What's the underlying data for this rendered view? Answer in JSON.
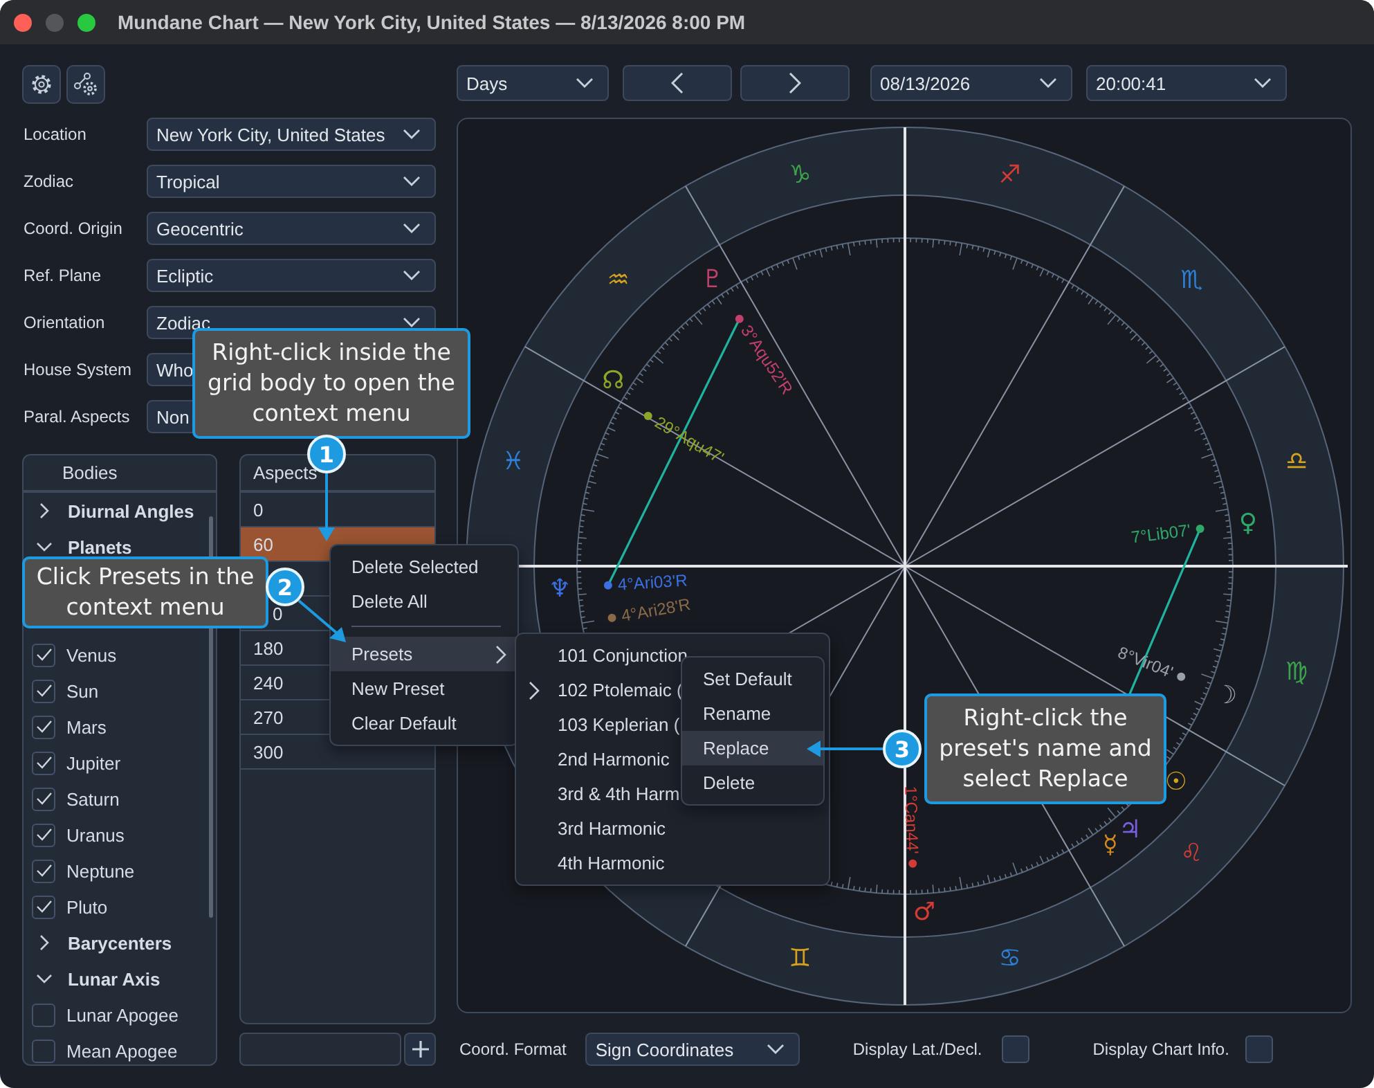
{
  "window": {
    "title": "Mundane Chart — New York City, United States — 8/13/2026 8:00 PM"
  },
  "settings": [
    {
      "label": "Location",
      "value": "New York City, United States"
    },
    {
      "label": "Zodiac",
      "value": "Tropical"
    },
    {
      "label": "Coord. Origin",
      "value": "Geocentric"
    },
    {
      "label": "Ref. Plane",
      "value": "Ecliptic"
    },
    {
      "label": "Orientation",
      "value": "Zodiac"
    },
    {
      "label": "House System",
      "value": "Who"
    },
    {
      "label": "Paral. Aspects",
      "value": "Non"
    }
  ],
  "bodies": {
    "title": "Bodies",
    "items": [
      {
        "kind": "group",
        "label": "Diurnal Angles",
        "expanded": false
      },
      {
        "kind": "group",
        "label": "Planets",
        "expanded": true
      },
      {
        "kind": "covered"
      },
      {
        "kind": "covered"
      },
      {
        "kind": "body",
        "label": "Venus",
        "checked": true
      },
      {
        "kind": "body",
        "label": "Sun",
        "checked": true
      },
      {
        "kind": "body",
        "label": "Mars",
        "checked": true
      },
      {
        "kind": "body",
        "label": "Jupiter",
        "checked": true
      },
      {
        "kind": "body",
        "label": "Saturn",
        "checked": true
      },
      {
        "kind": "body",
        "label": "Uranus",
        "checked": true
      },
      {
        "kind": "body",
        "label": "Neptune",
        "checked": true
      },
      {
        "kind": "body",
        "label": "Pluto",
        "checked": true
      },
      {
        "kind": "group",
        "label": "Barycenters",
        "expanded": false
      },
      {
        "kind": "group",
        "label": "Lunar Axis",
        "expanded": true
      },
      {
        "kind": "body",
        "label": "Lunar Apogee",
        "checked": false
      },
      {
        "kind": "body",
        "label": "Mean Apogee",
        "checked": false
      }
    ]
  },
  "aspects": {
    "title": "Aspects",
    "rows": [
      {
        "kind": "value",
        "value": "0",
        "selected": false
      },
      {
        "kind": "value",
        "value": "60",
        "selected": true
      },
      {
        "kind": "covered"
      },
      {
        "kind": "tail",
        "value": "0",
        "selected": false
      },
      {
        "kind": "value",
        "value": "180",
        "selected": false
      },
      {
        "kind": "value",
        "value": "240",
        "selected": false
      },
      {
        "kind": "value",
        "value": "270",
        "selected": false
      },
      {
        "kind": "value",
        "value": "300",
        "selected": false
      }
    ]
  },
  "date_nav": {
    "unit": "Days",
    "date": "08/13/2026",
    "time": "20:00:41"
  },
  "chart": {
    "signs": [
      {
        "glyph": "♑",
        "color": "#3ea24a"
      },
      {
        "glyph": "♐",
        "color": "#d33b35"
      },
      {
        "glyph": "♒",
        "color": "#d6a11c"
      },
      {
        "glyph": "♏",
        "color": "#2f7fd6"
      },
      {
        "glyph": "♓",
        "color": "#2f7fd6"
      },
      {
        "glyph": "♎",
        "color": "#d6a11c"
      },
      {
        "glyph": "♍",
        "color": "#3ea24a"
      },
      {
        "glyph": "♌",
        "color": "#d33b35"
      },
      {
        "glyph": "♊",
        "color": "#d6a11c"
      },
      {
        "glyph": "♋",
        "color": "#2f7fd6"
      }
    ],
    "planets": [
      {
        "glyph": "♇",
        "label": "3°Aqu52'R",
        "color": "#c2416c"
      },
      {
        "glyph": "☊",
        "label": "29°Aqu47'",
        "color": "#8ea52a"
      },
      {
        "glyph": "♀",
        "label": "7°Lib07'",
        "color": "#2fa86a"
      },
      {
        "glyph": "♆",
        "label": "4°Ari03'R",
        "color": "#3b6fe2"
      },
      {
        "label": "4°Ari28'R",
        "color": "#8a6a47"
      },
      {
        "glyph": "☽",
        "label": "8°Vir04'",
        "color": "#9aa0aa"
      },
      {
        "glyph": "☉",
        "color": "#d6a11c"
      },
      {
        "glyph": "♃",
        "color": "#7a5fe0"
      },
      {
        "glyph": "☿",
        "color": "#d08a20"
      },
      {
        "glyph": "♂",
        "label": "1°Can44'",
        "color": "#d33b35"
      }
    ]
  },
  "bottom_bar": {
    "coord_format_label": "Coord. Format",
    "coord_format": "Sign Coordinates",
    "lat_decl_label": "Display Lat./Decl.",
    "lat_decl_checked": false,
    "chart_info_label": "Display Chart Info.",
    "chart_info_checked": false
  },
  "menus": [
    {
      "items": [
        {
          "kind": "item",
          "label": "Delete Selected",
          "highlighted": false
        },
        {
          "kind": "item",
          "label": "Delete All",
          "highlighted": false
        },
        {
          "kind": "separator"
        },
        {
          "kind": "item",
          "label": "Presets",
          "highlighted": true,
          "submenu": true
        },
        {
          "kind": "item",
          "label": "New Preset",
          "highlighted": false
        },
        {
          "kind": "item",
          "label": "Clear Default",
          "highlighted": false
        }
      ]
    },
    {
      "items": [
        {
          "kind": "item",
          "label": "101 Conjunction",
          "highlighted": false
        },
        {
          "kind": "item",
          "label": "102 Ptolemaic (",
          "highlighted": false,
          "submenu": true
        },
        {
          "kind": "item",
          "label": "103 Keplerian (",
          "highlighted": false
        },
        {
          "kind": "item",
          "label": "2nd Harmonic",
          "highlighted": false
        },
        {
          "kind": "item",
          "label": "3rd & 4th Harm",
          "highlighted": false
        },
        {
          "kind": "item",
          "label": "3rd Harmonic",
          "highlighted": false
        },
        {
          "kind": "item",
          "label": "4th Harmonic",
          "highlighted": false
        }
      ]
    },
    {
      "items": [
        {
          "kind": "item",
          "label": "Set Default",
          "highlighted": false
        },
        {
          "kind": "item",
          "label": "Rename",
          "highlighted": false
        },
        {
          "kind": "item",
          "label": "Replace",
          "highlighted": true
        },
        {
          "kind": "item",
          "label": "Delete",
          "highlighted": false
        }
      ]
    }
  ],
  "callouts": [
    {
      "number": "1",
      "text": "Right-click inside the grid body to open the context menu"
    },
    {
      "number": "2",
      "text": "Click Presets in the context menu"
    },
    {
      "number": "3",
      "text": "Right-click the preset's name and select Replace"
    }
  ]
}
